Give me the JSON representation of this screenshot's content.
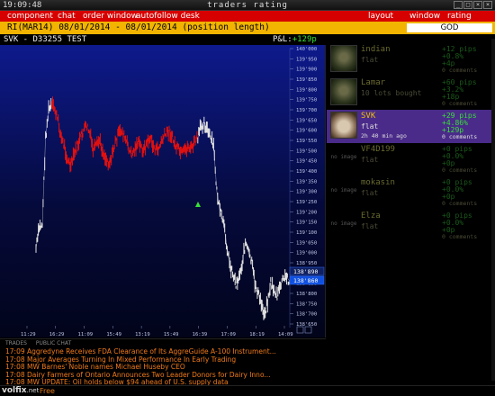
{
  "window": {
    "clock": "19:09:48",
    "title": "traders rating",
    "controls": [
      "_",
      "□",
      "×",
      "×"
    ]
  },
  "menu": {
    "items": [
      "component",
      "chat",
      "order window",
      "autofollow desk",
      "layout",
      "window",
      "rating setup"
    ]
  },
  "instrument_bar": {
    "instrument": "RI(MAR14) 08/01/2014 - 08/01/2014 (position length)",
    "rating": "GOD"
  },
  "chart_header": {
    "account": "SVK - D33255 TEST",
    "pnl_label": "P&L:",
    "pnl_value": "+129p"
  },
  "chart_data": {
    "type": "line",
    "x_ticks": [
      "11:29",
      "16:29",
      "11:09",
      "15:49",
      "13:19",
      "15:49",
      "16:39",
      "17:09",
      "18:19",
      "14:09"
    ],
    "y_ticks": [
      "140'000",
      "139'950",
      "139'900",
      "139'850",
      "139'800",
      "139'750",
      "139'700",
      "139'650",
      "139'600",
      "139'550",
      "139'500",
      "139'450",
      "139'400",
      "139'350",
      "139'300",
      "139'250",
      "139'200",
      "139'150",
      "139'100",
      "139'050",
      "139'000",
      "138'950",
      "138'900",
      "138'850",
      "138'800",
      "138'750",
      "138'700",
      "138'650"
    ],
    "ylim": [
      138650,
      140000
    ],
    "current_price_labels": [
      "138'890",
      "138'860"
    ],
    "series": [
      {
        "color": "#e0e0e0",
        "values": [
          139020,
          139120,
          139140,
          139560,
          139700,
          139720
        ]
      },
      {
        "color": "#e01010",
        "values": [
          139720,
          139700,
          139640,
          139560,
          139520,
          139450,
          139420,
          139480,
          139520,
          139560,
          139600,
          139620,
          139580,
          139500,
          139520,
          139550,
          139500,
          139460,
          139440,
          139480,
          139540,
          139580,
          139600,
          139560,
          139520,
          139480,
          139500,
          139540,
          139520,
          139500,
          139540,
          139560,
          139520,
          139500,
          139520,
          139560,
          139580,
          139600,
          139560,
          139520,
          139500,
          139480,
          139500,
          139520,
          139510,
          139540,
          139560
        ]
      },
      {
        "color": "#e0e0e0",
        "values": [
          139560,
          139620,
          139640,
          139600,
          139560,
          139520,
          139300,
          139200,
          139150,
          139050,
          138950,
          138900,
          138850,
          138880,
          138950,
          139050,
          139000,
          138950,
          138850,
          138800,
          138750,
          138700,
          138760,
          138850,
          138820,
          138780,
          138840,
          138870,
          138880,
          138860
        ]
      }
    ]
  },
  "traders": [
    {
      "name": "indian",
      "position": "flat",
      "time": "",
      "pips": "+12 pips",
      "pct": "+0.8%",
      "pp": "+4p",
      "comments": "0 comments",
      "state": "dim",
      "avatar": "photo"
    },
    {
      "name": "Lamar",
      "position": "10 lots bought",
      "time": "",
      "pips": "+60 pips",
      "pct": "+3.2%",
      "pp": "+18p",
      "comments": "0 comments",
      "state": "dim",
      "avatar": "photo"
    },
    {
      "name": "SVK",
      "position": "flat",
      "time": "2h 40 min ago",
      "pips": "+29 pips",
      "pct": "+4.86%",
      "pp": "+129p",
      "comments": "0 comments",
      "state": "active",
      "avatar": "dog"
    },
    {
      "name": "VF4D199",
      "position": "flat",
      "time": "",
      "pips": "+0 pips",
      "pct": "+0.0%",
      "pp": "+0p",
      "comments": "0 comments",
      "state": "dim",
      "avatar": "no image"
    },
    {
      "name": "mokasin",
      "position": "flat",
      "time": "",
      "pips": "+0 pips",
      "pct": "+0.0%",
      "pp": "+0p",
      "comments": "0 comments",
      "state": "dim",
      "avatar": "no image"
    },
    {
      "name": "Elza",
      "position": "flat",
      "time": "",
      "pips": "+0 pips",
      "pct": "+0.0%",
      "pp": "+0p",
      "comments": "0 comments",
      "state": "dim",
      "avatar": "no image"
    }
  ],
  "news": {
    "tabs": [
      "TRADES",
      "PUBLIC CHAT"
    ],
    "rows": [
      {
        "time": "17:09",
        "text": "Aggredyne Receives FDA Clearance of Its AggreGuide A-100 Instrument..."
      },
      {
        "time": "17:08",
        "text": "Major Averages Turning In Mixed Performance In Early Trading"
      },
      {
        "time": "17:08",
        "text": "MW Barnes' Noble names Michael Huseby CEO"
      },
      {
        "time": "17:08",
        "text": "Dairy Farmers of Ontario Announces Two Leader Donors for Dairy Inno..."
      },
      {
        "time": "17:08",
        "text": "MW UPDATE: Oil holds below $94 ahead of U.S. supply data"
      }
    ]
  },
  "footer": {
    "logo": "volfix",
    "logo_suffix": ".net",
    "plan": "Free"
  },
  "colors": {
    "menu_bar": "#d70000",
    "instrument_bar": "#f2b400",
    "active_trader": "#4a2b8a",
    "profit": "#38e038",
    "news_text": "#f07a1a"
  }
}
